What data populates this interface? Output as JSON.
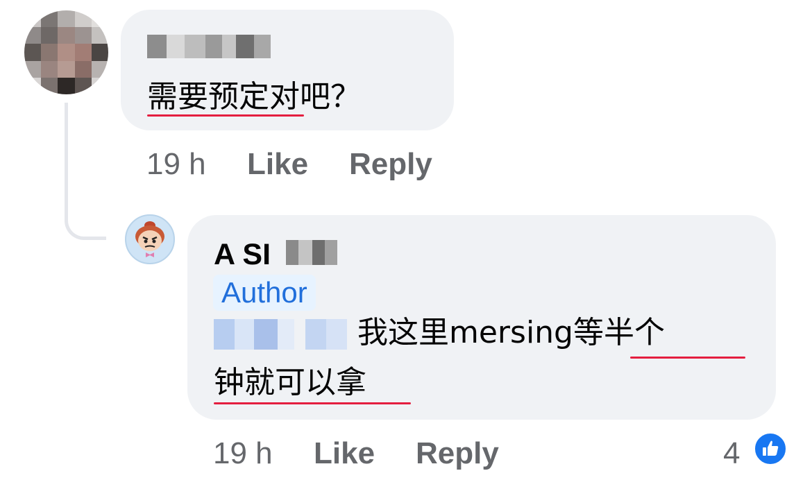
{
  "comments": [
    {
      "author_name_hidden": true,
      "text": "需要预定对吧？",
      "timestamp": "19 h",
      "like_label": "Like",
      "reply_label": "Reply"
    },
    {
      "author_name_visible": "A SI",
      "badge": "Author",
      "text": "我这里mersing等半个",
      "text_line2": "钟就可以拿",
      "timestamp": "19 h",
      "like_label": "Like",
      "reply_label": "Reply",
      "reaction_count": "4",
      "reaction_icon": "like-thumb-icon"
    }
  ],
  "colors": {
    "bubble": "#f0f2f5",
    "meta_text": "#65676b",
    "author_badge_bg": "#e7f3ff",
    "author_badge_text": "#216fdb",
    "like_blue": "#1877f2",
    "spellcheck_underline": "#e41e3f"
  }
}
